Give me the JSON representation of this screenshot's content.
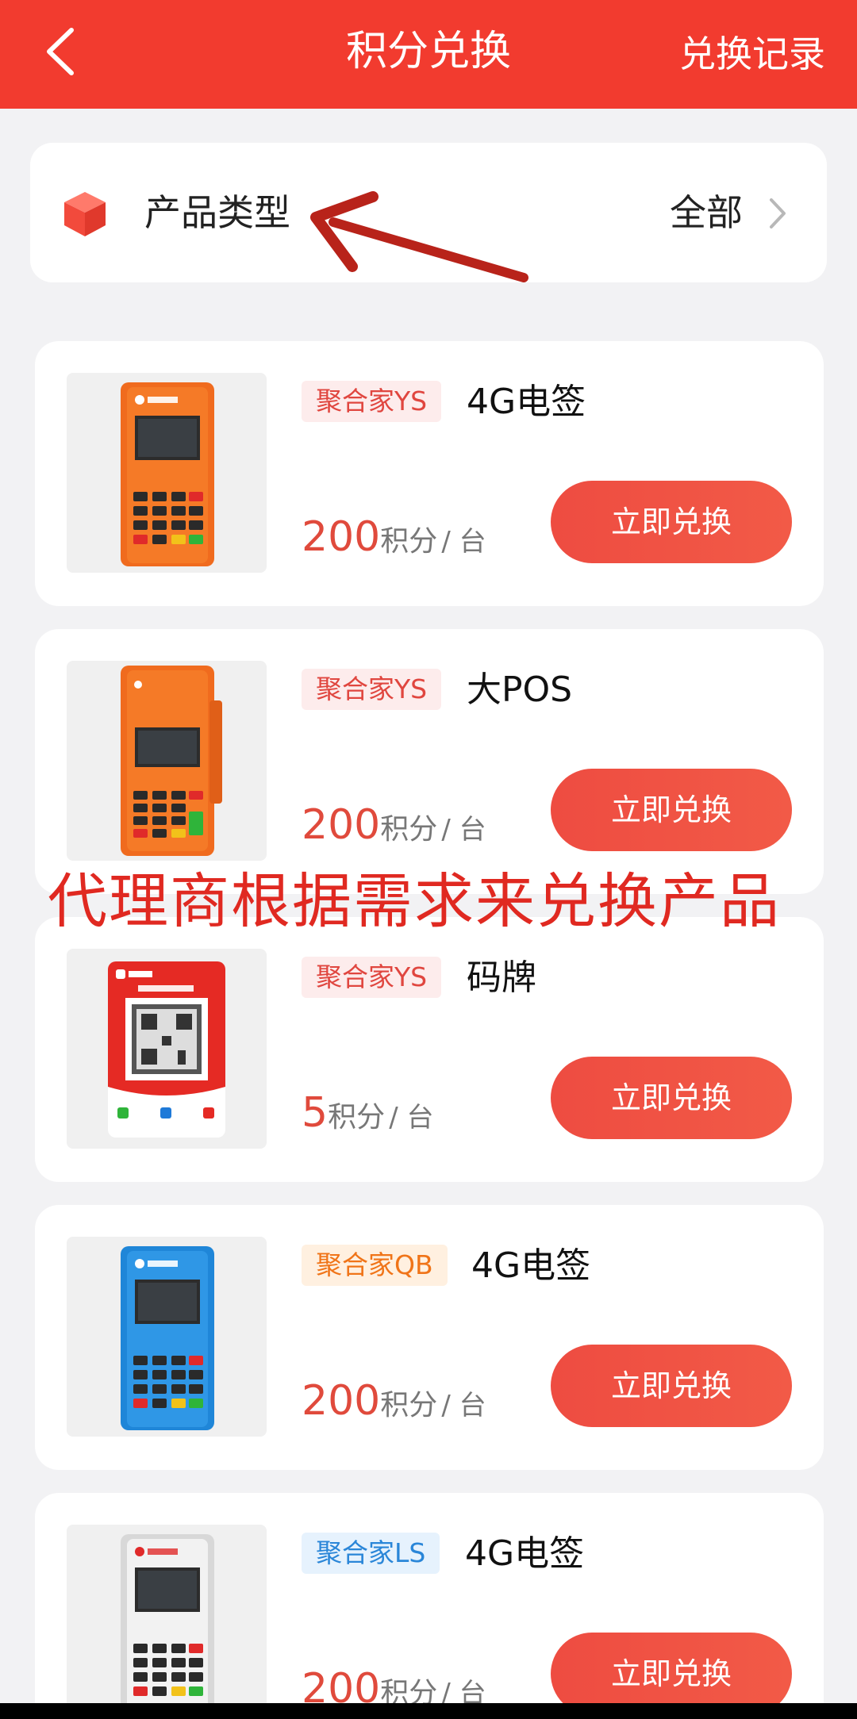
{
  "header": {
    "back_icon": "chevron-left-icon",
    "title": "积分兑换",
    "record_label": "兑换记录",
    "bg_color": "#f23b2f"
  },
  "filter": {
    "icon": "cube-icon",
    "label": "产品类型",
    "value": "全部",
    "chevron_icon": "chevron-right-icon"
  },
  "products": [
    {
      "tag": "聚合家YS",
      "tag_style": "red",
      "name": "4G电签",
      "points": "200",
      "unit": "积分",
      "per": "/ 台",
      "button": "立即兑换",
      "device": "orange-4g-terminal"
    },
    {
      "tag": "聚合家YS",
      "tag_style": "red",
      "name": "大POS",
      "points": "200",
      "unit": "积分",
      "per": "/ 台",
      "button": "立即兑换",
      "device": "orange-big-pos"
    },
    {
      "tag": "聚合家YS",
      "tag_style": "red",
      "name": "码牌",
      "points": "5",
      "unit": "积分",
      "per": "/ 台",
      "button": "立即兑换",
      "device": "qr-code-stand"
    },
    {
      "tag": "聚合家QB",
      "tag_style": "orange",
      "name": "4G电签",
      "points": "200",
      "unit": "积分",
      "per": "/ 台",
      "button": "立即兑换",
      "device": "blue-4g-terminal"
    },
    {
      "tag": "聚合家LS",
      "tag_style": "blue",
      "name": "4G电签",
      "points": "200",
      "unit": "积分",
      "per": "/ 台",
      "button": "立即兑换",
      "device": "white-4g-terminal"
    }
  ],
  "annotation": {
    "text": "代理商根据需求来兑换产品",
    "color": "#e02921",
    "arrow_icon": "arrow-icon"
  }
}
